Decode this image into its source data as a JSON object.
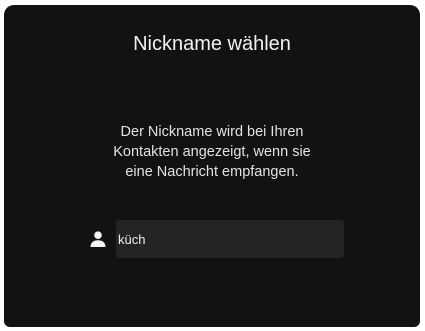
{
  "dialog": {
    "title": "Nickname wählen",
    "description_lines": [
      "Der Nickname wird bei Ihren",
      "Kontakten angezeigt, wenn sie",
      "eine Nachricht empfangen."
    ]
  },
  "nickname_field": {
    "value": "küch",
    "icon": "user-icon"
  },
  "colors": {
    "background": "#121212",
    "field_background": "#242424",
    "text": "#f2f2f2",
    "caret": "#2f8cff"
  }
}
